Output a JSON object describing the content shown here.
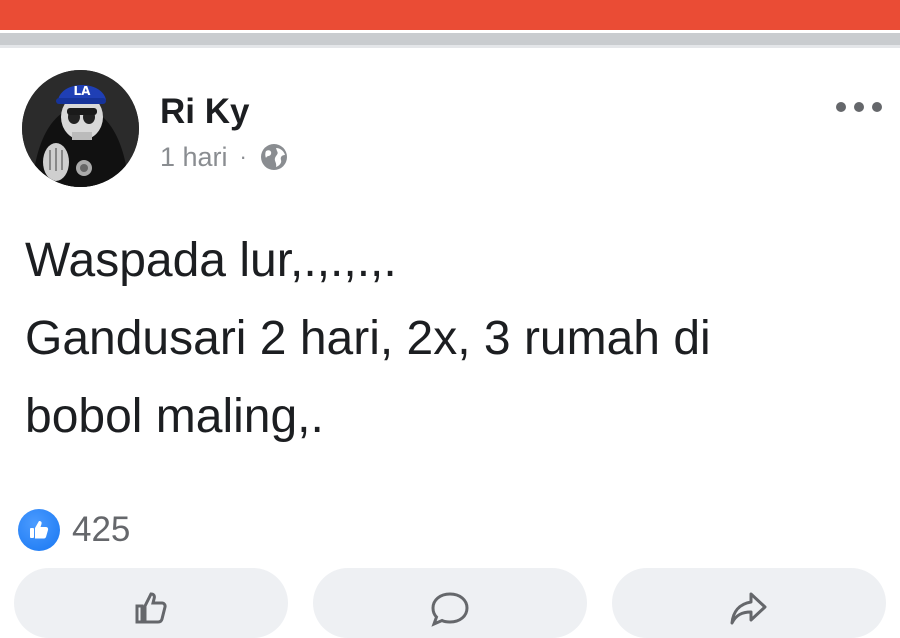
{
  "post": {
    "author": "Ri Ky",
    "time": "1 hari",
    "separator": "·",
    "visibility_icon": "globe-icon",
    "text_lines": [
      "Waspada lur,.,.,.,.",
      "Gandusari 2 hari, 2x, 3 rumah di",
      "bobol maling,."
    ],
    "reactions": {
      "icon": "like-icon",
      "count": "425"
    }
  },
  "actions": [
    {
      "icon": "like-icon"
    },
    {
      "icon": "comment-icon"
    },
    {
      "icon": "share-icon"
    }
  ],
  "colors": {
    "top_bar": "#ea4c35",
    "divider": "#c9cccf",
    "like_blue": "#1877f2",
    "secondary_text": "#8a8d91",
    "button_bg": "#eef0f3"
  }
}
